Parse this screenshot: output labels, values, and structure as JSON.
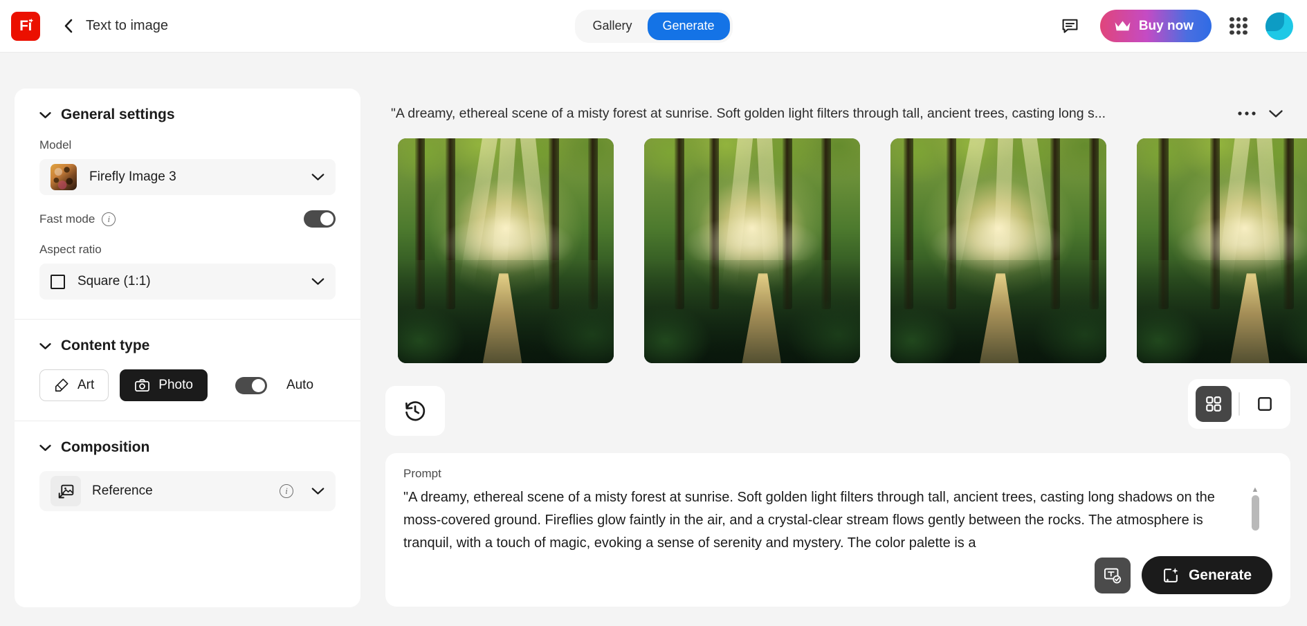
{
  "app": {
    "logo_text": "Fi",
    "page_title": "Text to image"
  },
  "header": {
    "back_icon": "chevron-left-icon",
    "tabs": [
      {
        "label": "Gallery",
        "active": false
      },
      {
        "label": "Generate",
        "active": true
      }
    ],
    "chat_icon": "chat-bubble-icon",
    "buy_now_label": "Buy now",
    "buy_now_icon": "crown-icon",
    "apps_icon": "app-grid-icon",
    "avatar_icon": "user-avatar",
    "accent_blue": "#1473e6",
    "brand_red": "#eb1000"
  },
  "sidebar": {
    "general": {
      "title": "General settings",
      "model_label": "Model",
      "model_value": "Firefly Image 3",
      "fast_mode_label": "Fast mode",
      "fast_mode_on": true,
      "aspect_label": "Aspect ratio",
      "aspect_value": "Square (1:1)"
    },
    "content_type": {
      "title": "Content type",
      "art_label": "Art",
      "photo_label": "Photo",
      "selected": "Photo",
      "auto_label": "Auto",
      "auto_on": true
    },
    "composition": {
      "title": "Composition",
      "reference_label": "Reference"
    }
  },
  "main": {
    "prompt_header": "\"A dreamy, ethereal scene of a misty forest at sunrise. Soft golden light filters through tall, ancient trees, casting long s...",
    "more_icon": "ellipsis-icon",
    "collapse_icon": "chevron-down-icon",
    "history_icon": "history-clock-icon",
    "view_grid_icon": "grid-view-icon",
    "view_single_icon": "single-view-icon",
    "view_mode": "grid",
    "results_count": 4,
    "prompt": {
      "label": "Prompt",
      "value": "\"A dreamy, ethereal scene of a misty forest at sunrise. Soft golden light filters through tall, ancient trees, casting long shadows on the moss-covered ground. Fireflies glow faintly in the air, and a crystal-clear stream flows gently between the rocks. The atmosphere is tranquil, with a touch of magic, evoking a sense of serenity and mystery. The color palette is a",
      "assist_icon": "text-check-icon",
      "generate_label": "Generate",
      "generate_icon": "sparkle-image-icon"
    }
  }
}
